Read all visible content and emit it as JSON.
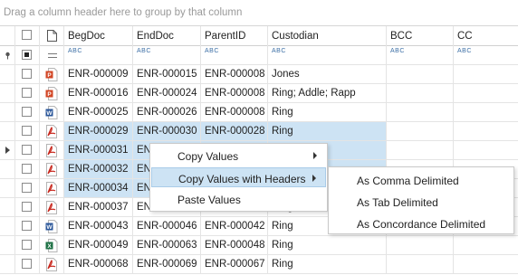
{
  "group_panel": {
    "hint": "Drag a column header here to group by that column"
  },
  "columns": [
    "BegDoc",
    "EndDoc",
    "ParentID",
    "Custodian",
    "BCC",
    "CC"
  ],
  "filter_row": {
    "text_marker": "ABC"
  },
  "rows": [
    {
      "icon": "ppt",
      "begdoc": "ENR-000009",
      "enddoc": "ENR-000015",
      "parentid": "ENR-000008",
      "custodian": "Jones",
      "selected": false
    },
    {
      "icon": "ppt",
      "begdoc": "ENR-000016",
      "enddoc": "ENR-000024",
      "parentid": "ENR-000008",
      "custodian": "Ring; Addle; Rapp",
      "selected": false
    },
    {
      "icon": "word",
      "begdoc": "ENR-000025",
      "enddoc": "ENR-000026",
      "parentid": "ENR-000008",
      "custodian": "Ring",
      "selected": false
    },
    {
      "icon": "pdf",
      "begdoc": "ENR-000029",
      "enddoc": "ENR-000030",
      "parentid": "ENR-000028",
      "custodian": "Ring",
      "selected": true
    },
    {
      "icon": "pdf",
      "begdoc": "ENR-000031",
      "enddoc": "EN",
      "parentid": "",
      "custodian": "",
      "selected": true
    },
    {
      "icon": "pdf",
      "begdoc": "ENR-000032",
      "enddoc": "EN",
      "parentid": "",
      "custodian": "",
      "selected": true
    },
    {
      "icon": "pdf",
      "begdoc": "ENR-000034",
      "enddoc": "EN",
      "parentid": "",
      "custodian": "",
      "selected": true
    },
    {
      "icon": "pdf",
      "begdoc": "ENR-000037",
      "enddoc": "EN",
      "parentid": "",
      "custodian": "Ring",
      "selected": false
    },
    {
      "icon": "word",
      "begdoc": "ENR-000043",
      "enddoc": "ENR-000046",
      "parentid": "ENR-000042",
      "custodian": "Ring",
      "selected": false
    },
    {
      "icon": "excel",
      "begdoc": "ENR-000049",
      "enddoc": "ENR-000063",
      "parentid": "ENR-000048",
      "custodian": "Ring",
      "selected": false
    },
    {
      "icon": "pdf",
      "begdoc": "ENR-000068",
      "enddoc": "ENR-000069",
      "parentid": "ENR-000067",
      "custodian": "Ring",
      "selected": false
    }
  ],
  "context_menu": {
    "items": [
      "Copy Values",
      "Copy Values with Headers",
      "Paste Values"
    ]
  },
  "submenu": {
    "items": [
      "As Comma Delimited",
      "As Tab Delimited",
      "As Concordance Delimited"
    ]
  },
  "colors": {
    "selection": "#cde3f4",
    "grid_line": "#e4e4e4",
    "pdf_red": "#c8281e",
    "word_blue": "#2a5699",
    "excel_green": "#1e7145",
    "ppt_orange": "#d24726"
  }
}
